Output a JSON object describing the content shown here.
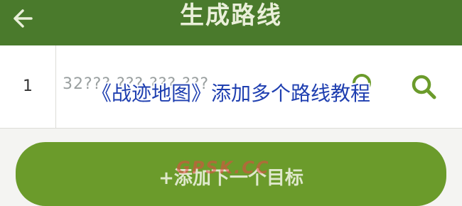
{
  "header": {
    "title": "生成路线",
    "back_icon": "arrow-left-icon"
  },
  "route_row": {
    "index": "1",
    "coords": "32??? ??? ??? ???",
    "locate_icon": "locate-icon",
    "search_icon": "search-icon"
  },
  "overlay": {
    "title": "《战迹地图》添加多个路线教程"
  },
  "add_button": {
    "label": "+添加下一个目标"
  },
  "watermark": {
    "text": "GPSK.CC"
  },
  "colors": {
    "header_bg": "#4a7a2c",
    "button_bg": "#6b9b2b",
    "overlay_text": "#1f3fb0"
  }
}
